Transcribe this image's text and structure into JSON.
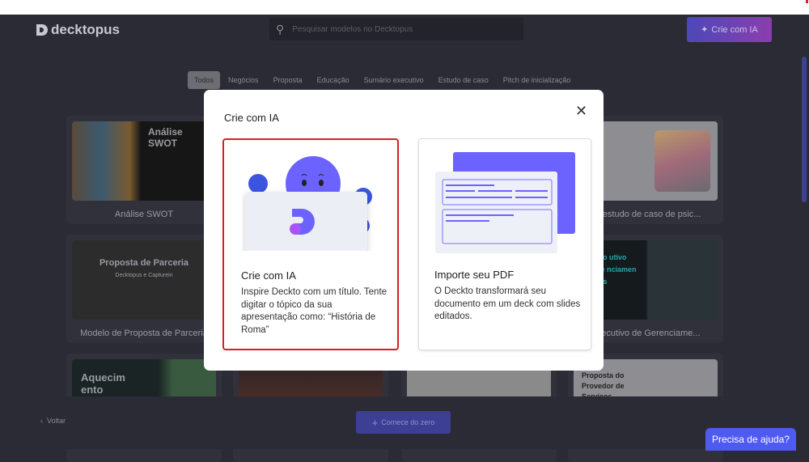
{
  "header": {
    "logo_text": "decktopus",
    "search_placeholder": "Pesquisar modelos no Decktopus",
    "cta_label": "Crie com IA"
  },
  "tabs": [
    {
      "label": "Todos",
      "active": true
    },
    {
      "label": "Negócios"
    },
    {
      "label": "Proposta"
    },
    {
      "label": "Educação"
    },
    {
      "label": "Sumário executivo"
    },
    {
      "label": "Estudo de caso"
    },
    {
      "label": "Pitch de inicialização"
    }
  ],
  "templates": [
    {
      "caption": "Análise SWOT",
      "thumb_title": "Análise SWOT"
    },
    {
      "caption": "de estudo de caso de psic...",
      "thumb_title": "de caso cologia"
    },
    {
      "caption": "Modelo de Proposta de Parceria",
      "thumb_title": "Proposta de Parceria",
      "thumb_sub": "Decktopus e Capturein"
    },
    {
      "caption": "Executivo de Gerenciame...",
      "thumb_title": "mo utivo de nciamen tos"
    },
    {
      "thumb_title": "Aquecim ento"
    },
    {
      "thumb_title": "Proposta do Provedor de Serviços"
    }
  ],
  "footer": {
    "back_label": "Voltar",
    "start_label": "Comece do zero",
    "help_label": "Precisa de ajuda?"
  },
  "modal": {
    "title": "Crie com IA",
    "options": [
      {
        "title": "Crie com IA",
        "description": "Inspire Deckto com um título. Tente digitar o tópico da sua apresentação como: “História de Roma”"
      },
      {
        "title": "Importe seu PDF",
        "description": "O Deckto transformará seu documento em um deck com slides editados."
      }
    ]
  },
  "colors": {
    "accent": "#6c63ff",
    "highlight": "#d81f26",
    "help": "#4f5af0"
  }
}
